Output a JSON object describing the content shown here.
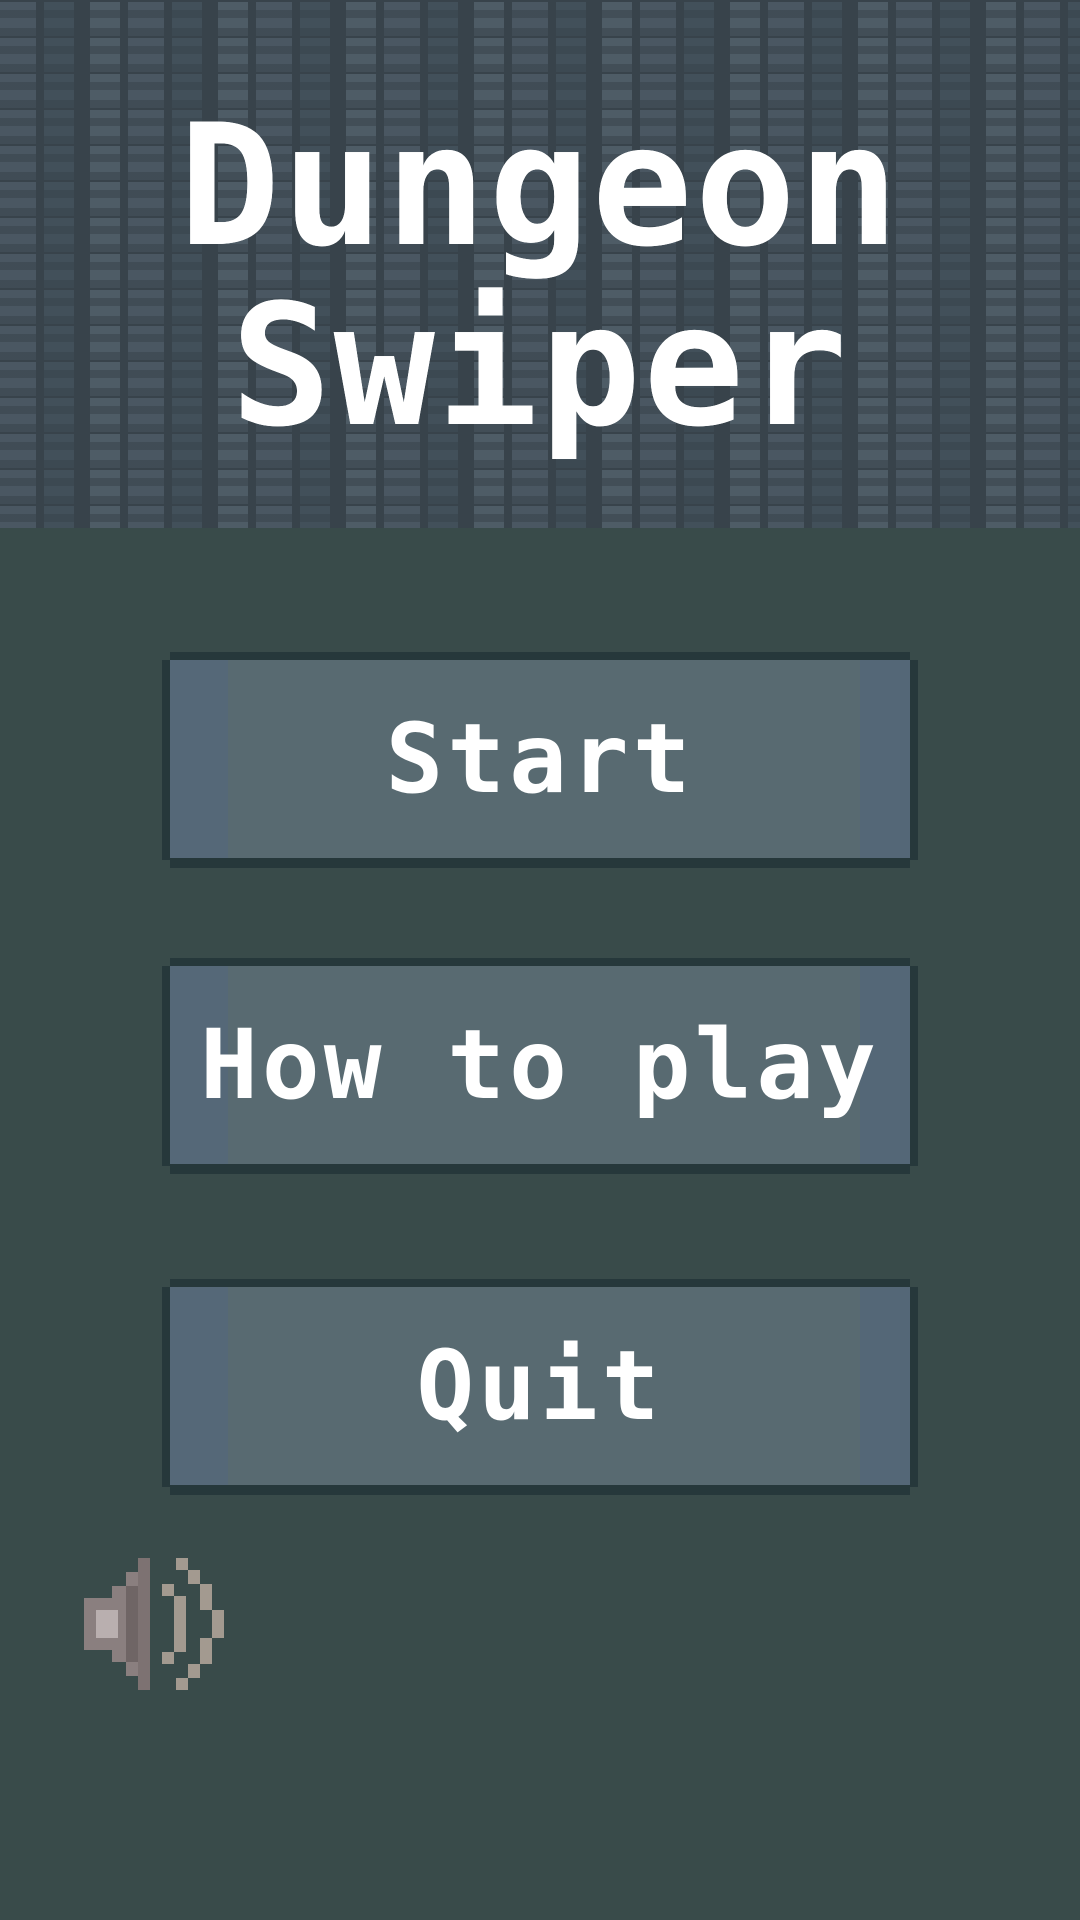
{
  "title": {
    "line1": "Dungeon",
    "line2": "Swiper"
  },
  "menu": {
    "start_label": "Start",
    "howto_label": "How to play",
    "quit_label": "Quit"
  },
  "sound": {
    "icon": "speaker-volume-icon"
  },
  "colors": {
    "background": "#394b4a",
    "button_fill": "#586a71",
    "button_border": "#26383b",
    "text": "#ffffff",
    "brick_dark": "#38434b"
  }
}
